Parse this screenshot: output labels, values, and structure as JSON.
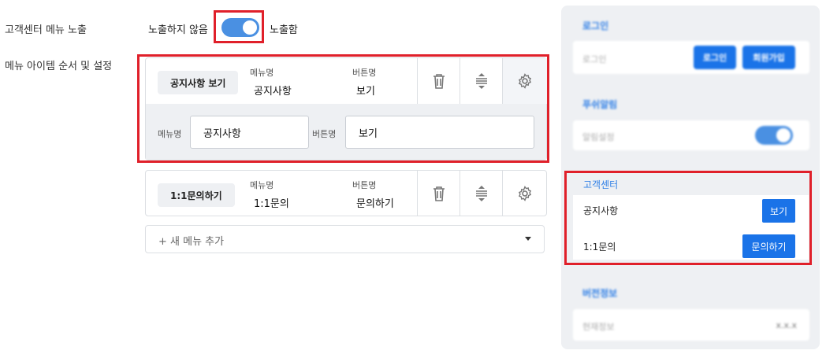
{
  "settings": {
    "exposure_label": "고객센터 메뉴 노출",
    "hide_label": "노출하지 않음",
    "show_label": "노출함",
    "toggle_on": true,
    "items_label": "메뉴 아이템 순서 및 설정"
  },
  "menu_items": [
    {
      "tag": "공지사항 보기",
      "menu_name_label": "메뉴명",
      "menu_name": "공지사항",
      "button_name_label": "버튼명",
      "button_name": "보기",
      "edit_menu_label": "메뉴명",
      "edit_menu_value": "공지사항",
      "edit_button_label": "버튼명",
      "edit_button_value": "보기"
    },
    {
      "tag": "1:1문의하기",
      "menu_name_label": "메뉴명",
      "menu_name": "1:1문의",
      "button_name_label": "버튼명",
      "button_name": "문의하기"
    }
  ],
  "add_menu": {
    "label": "+ 새 메뉴 추가"
  },
  "preview": {
    "login": {
      "title": "로그인",
      "placeholder": "로그인",
      "login_button": "로그인",
      "signup_button": "회원가입"
    },
    "push": {
      "title": "푸쉬알림",
      "setting_label": "알림설정",
      "toggle_on": true
    },
    "support": {
      "title": "고객센터",
      "rows": [
        {
          "label": "공지사항",
          "button": "보기"
        },
        {
          "label": "1:1문의",
          "button": "문의하기"
        }
      ]
    },
    "version": {
      "title": "버전정보",
      "current_label": "현재정보",
      "value": "x.x.x"
    }
  },
  "colors": {
    "accent": "#1a73e8",
    "toggle": "#4a90e2",
    "highlight": "#e0202a",
    "panel_bg": "#eef0f3"
  },
  "icons": [
    "trash-icon",
    "reorder-icon",
    "gear-icon",
    "chevron-down-icon"
  ]
}
